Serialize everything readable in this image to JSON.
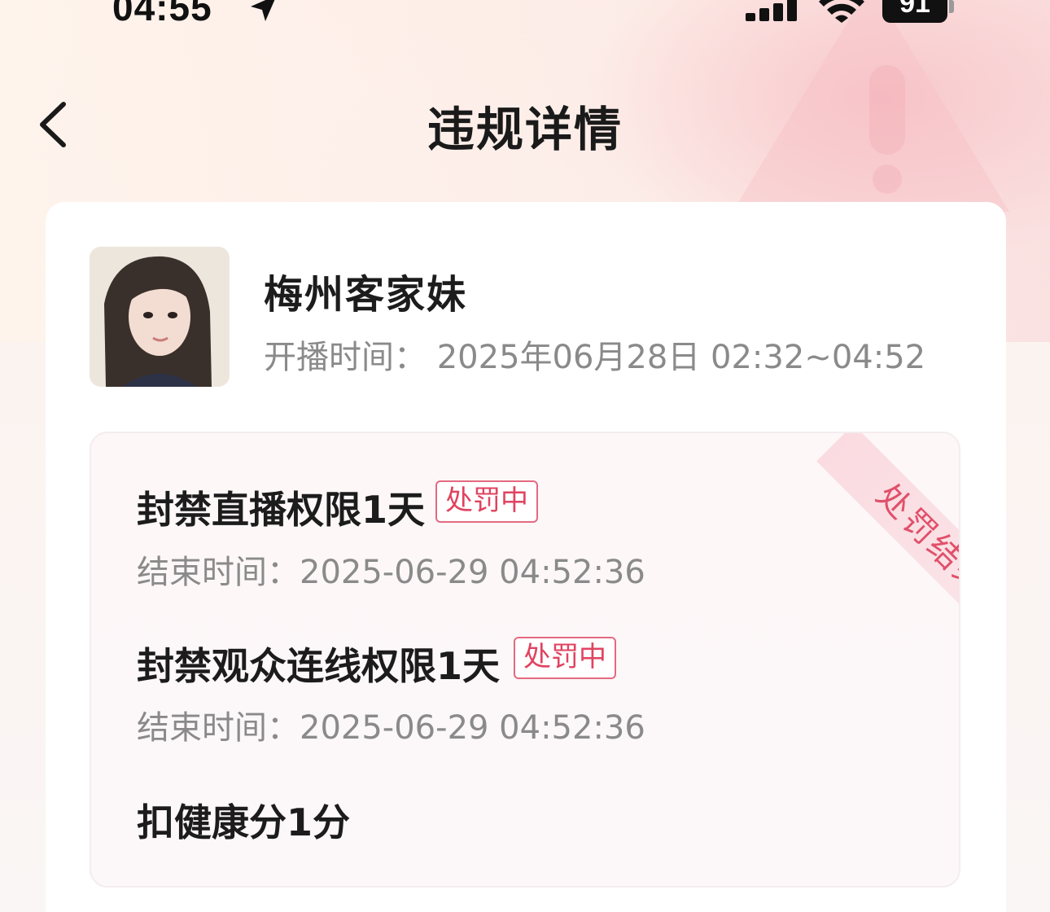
{
  "status_bar": {
    "time": "04:55",
    "battery": "91"
  },
  "nav": {
    "title": "违规详情"
  },
  "user": {
    "name": "梅州客家妹",
    "stream_time_label": "开播时间：",
    "stream_time_value": "2025年06月28日 02:32~04:52"
  },
  "result": {
    "ribbon_label": "处罚结果",
    "penalties": [
      {
        "title": "封禁直播权限1天",
        "badge": "处罚中",
        "end_label": "结束时间：",
        "end_value": "2025-06-29 04:52:36"
      },
      {
        "title": "封禁观众连线权限1天",
        "badge": "处罚中",
        "end_label": "结束时间：",
        "end_value": "2025-06-29 04:52:36"
      },
      {
        "title": "扣健康分1分"
      }
    ]
  },
  "colors": {
    "accent": "#e04360",
    "text_primary": "#1c1c1c",
    "text_secondary": "#8a8a8a"
  }
}
